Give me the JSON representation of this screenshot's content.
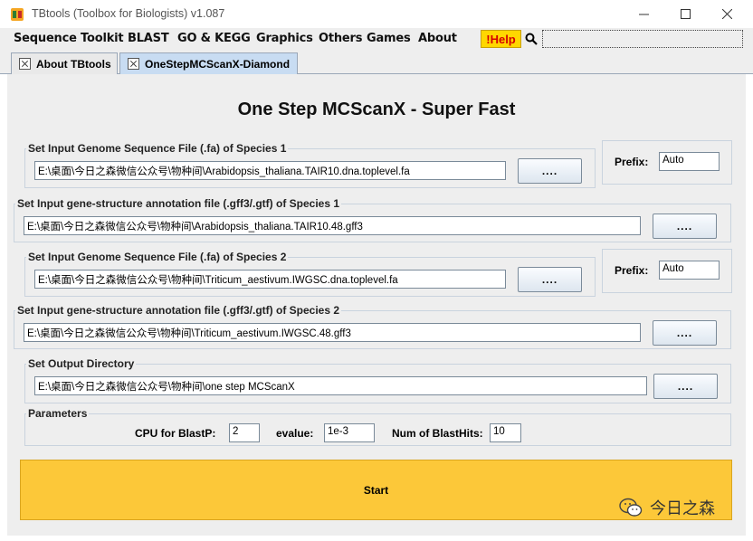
{
  "window": {
    "title": "TBtools (Toolbox for Biologists) v1.087",
    "minimize": "—",
    "maximize": "☐",
    "close": "✕"
  },
  "menu": {
    "items": [
      "Sequence Toolkit",
      "BLAST",
      "GO & KEGG",
      "Graphics",
      "Others",
      "Games",
      "About"
    ],
    "help_label": "!Help"
  },
  "tabs": [
    {
      "label": "About TBtools",
      "active": false
    },
    {
      "label": "OneStepMCScanX-Diamond",
      "active": true
    }
  ],
  "main": {
    "heading": "One Step MCScanX - Super Fast",
    "browse_label": "....",
    "species1_fa": {
      "title": "Set Input Genome Sequence File (.fa) of Species 1",
      "path": "E:\\桌面\\今日之森微信公众号\\物种间\\Arabidopsis_thaliana.TAIR10.dna.toplevel.fa"
    },
    "prefix1": {
      "label": "Prefix:",
      "value": "Auto"
    },
    "species1_gff": {
      "title": "Set Input gene-structure annotation file (.gff3/.gtf) of Species 1",
      "path": "E:\\桌面\\今日之森微信公众号\\物种间\\Arabidopsis_thaliana.TAIR10.48.gff3"
    },
    "species2_fa": {
      "title": "Set Input Genome Sequence File (.fa) of Species 2",
      "path": "E:\\桌面\\今日之森微信公众号\\物种间\\Triticum_aestivum.IWGSC.dna.toplevel.fa"
    },
    "prefix2": {
      "label": "Prefix:",
      "value": "Auto"
    },
    "species2_gff": {
      "title": "Set Input gene-structure annotation file (.gff3/.gtf) of Species 2",
      "path": "E:\\桌面\\今日之森微信公众号\\物种间\\Triticum_aestivum.IWGSC.48.gff3"
    },
    "output": {
      "title": "Set Output Directory",
      "path": "E:\\桌面\\今日之森微信公众号\\物种间\\one step MCScanX"
    },
    "parameters": {
      "title": "Parameters",
      "cpu_label": "CPU for BlastP:",
      "cpu_value": "2",
      "evalue_label": "evalue:",
      "evalue_value": "1e-3",
      "hits_label": "Num of BlastHits:",
      "hits_value": "10"
    },
    "start_label": "Start"
  },
  "watermark": "今日之森",
  "icons": {
    "app": "tbtools-logo-icon",
    "search": "search-icon",
    "tab_close": "close-icon",
    "watermark": "wechat-icon"
  },
  "colors": {
    "start_button": "#fcc839",
    "help_button": "#ffd700",
    "active_tab": "#c8dcf2"
  }
}
